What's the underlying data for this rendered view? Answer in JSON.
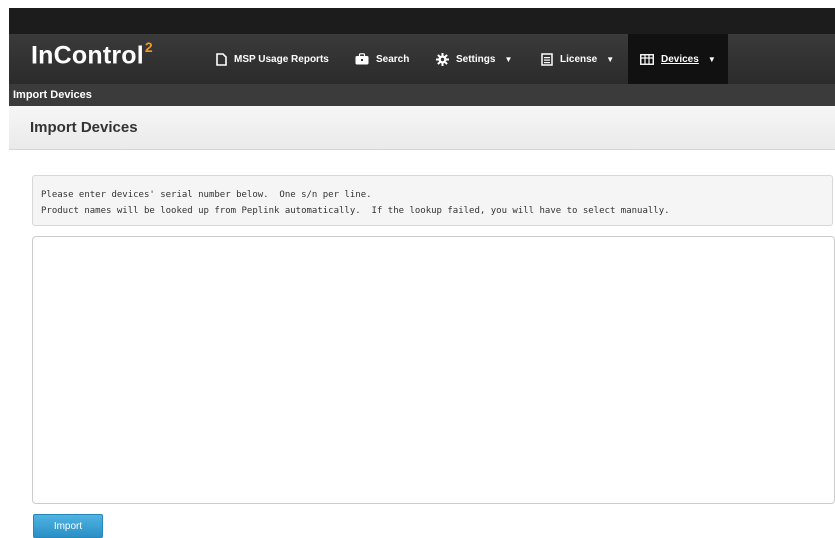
{
  "app": {
    "logo_text": "InControl",
    "logo_superscript": "2"
  },
  "nav": {
    "items": [
      {
        "label": "MSP Usage Reports",
        "icon": "document-icon",
        "dropdown": false
      },
      {
        "label": "Search",
        "icon": "briefcase-icon",
        "dropdown": false
      },
      {
        "label": "Settings",
        "icon": "gear-icon",
        "dropdown": true
      },
      {
        "label": "License",
        "icon": "list-document-icon",
        "dropdown": true
      },
      {
        "label": "Devices",
        "icon": "grid-table-icon",
        "dropdown": true,
        "active": true
      }
    ],
    "caret": "▼"
  },
  "breadcrumb": "Import Devices",
  "page": {
    "title": "Import Devices"
  },
  "instructions": {
    "line1": "Please enter devices' serial number below.  One s/n per line.",
    "line2": "Product names will be looked up from Peplink automatically.  If the lookup failed, you will have to select manually."
  },
  "form": {
    "serial_input_value": "",
    "import_label": "Import"
  },
  "colors": {
    "accent": "#f29a1e",
    "button": "#2a8fc6",
    "navbar": "#333333"
  }
}
